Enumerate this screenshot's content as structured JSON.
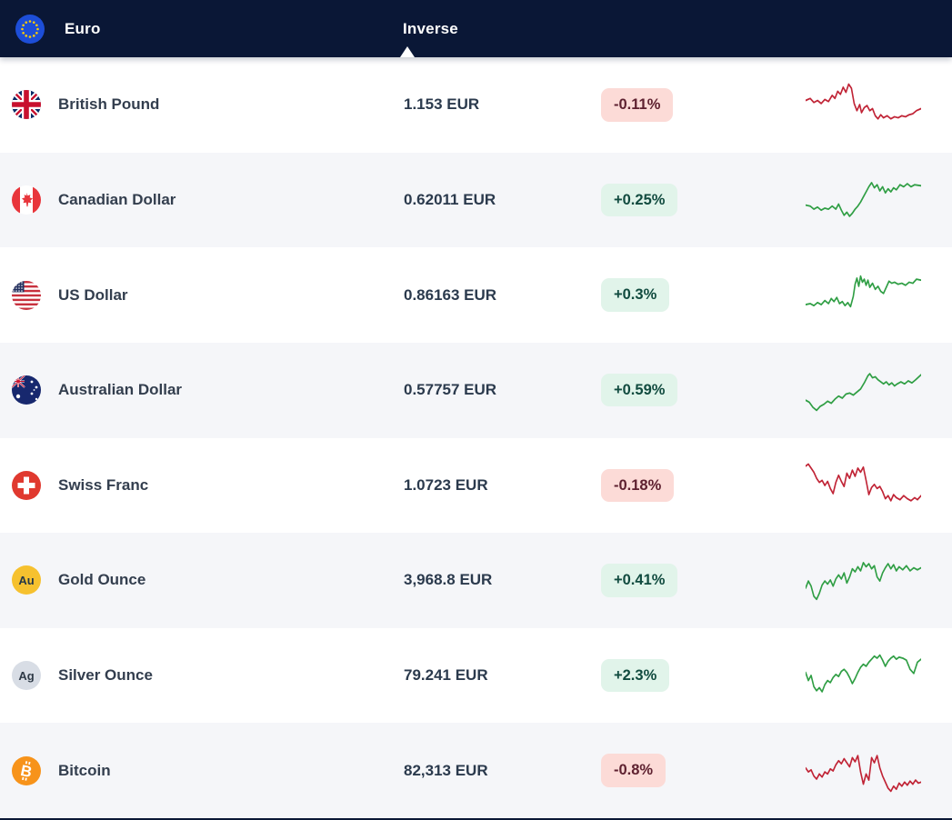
{
  "header": {
    "base_currency": "Euro",
    "inverse_label": "Inverse"
  },
  "colors": {
    "header_bg": "#0a1736",
    "spark_up": "#2f9e44",
    "spark_down": "#c02335",
    "badge_up_bg": "#e1f4ea",
    "badge_up_text": "#114b3f",
    "badge_down_bg": "#fcdbd7",
    "badge_down_text": "#5e2130",
    "row_alt_bg": "#f5f6f9"
  },
  "icons": {
    "eu": "eu-flag-icon",
    "gb": "uk-flag-icon",
    "ca": "canada-flag-icon",
    "us": "us-flag-icon",
    "au": "australia-flag-icon",
    "ch": "switzerland-flag-icon",
    "gold": "gold-au-icon",
    "silver": "silver-ag-icon",
    "btc": "bitcoin-icon"
  },
  "rows": [
    {
      "name": "British Pound",
      "icon": "gb",
      "rate": "1.153 EUR",
      "change": "-0.11%",
      "direction": "down",
      "spark": [
        [
          0,
          21
        ],
        [
          5,
          19
        ],
        [
          9,
          23
        ],
        [
          13,
          21
        ],
        [
          17,
          24
        ],
        [
          21,
          20
        ],
        [
          25,
          22
        ],
        [
          29,
          16
        ],
        [
          32,
          19
        ],
        [
          35,
          12
        ],
        [
          38,
          15
        ],
        [
          41,
          8
        ],
        [
          44,
          13
        ],
        [
          47,
          5
        ],
        [
          50,
          9
        ],
        [
          53,
          24
        ],
        [
          56,
          31
        ],
        [
          59,
          25
        ],
        [
          61,
          33
        ],
        [
          64,
          28
        ],
        [
          67,
          26
        ],
        [
          70,
          31
        ],
        [
          73,
          29
        ],
        [
          76,
          36
        ],
        [
          79,
          39
        ],
        [
          82,
          35
        ],
        [
          85,
          38
        ],
        [
          89,
          36
        ],
        [
          93,
          39
        ],
        [
          97,
          37
        ],
        [
          101,
          38
        ],
        [
          105,
          36
        ],
        [
          109,
          37
        ],
        [
          113,
          35
        ],
        [
          117,
          34
        ],
        [
          121,
          31
        ],
        [
          126,
          29
        ]
      ]
    },
    {
      "name": "Canadian Dollar",
      "icon": "ca",
      "rate": "0.62011 EUR",
      "change": "+0.25%",
      "direction": "up",
      "spark": [
        [
          0,
          30
        ],
        [
          5,
          31
        ],
        [
          9,
          34
        ],
        [
          13,
          32
        ],
        [
          17,
          35
        ],
        [
          21,
          33
        ],
        [
          25,
          34
        ],
        [
          29,
          31
        ],
        [
          33,
          34
        ],
        [
          36,
          29
        ],
        [
          39,
          35
        ],
        [
          42,
          40
        ],
        [
          45,
          37
        ],
        [
          48,
          41
        ],
        [
          51,
          38
        ],
        [
          54,
          34
        ],
        [
          57,
          31
        ],
        [
          60,
          27
        ],
        [
          63,
          22
        ],
        [
          66,
          17
        ],
        [
          69,
          12
        ],
        [
          72,
          8
        ],
        [
          75,
          13
        ],
        [
          78,
          10
        ],
        [
          81,
          16
        ],
        [
          84,
          12
        ],
        [
          87,
          18
        ],
        [
          90,
          14
        ],
        [
          93,
          17
        ],
        [
          96,
          13
        ],
        [
          99,
          15
        ],
        [
          103,
          10
        ],
        [
          107,
          12
        ],
        [
          111,
          9
        ],
        [
          115,
          12
        ],
        [
          119,
          10
        ],
        [
          126,
          11
        ]
      ]
    },
    {
      "name": "US Dollar",
      "icon": "us",
      "rate": "0.86163 EUR",
      "change": "+0.3%",
      "direction": "up",
      "spark": [
        [
          0,
          34
        ],
        [
          5,
          33
        ],
        [
          9,
          35
        ],
        [
          13,
          32
        ],
        [
          17,
          34
        ],
        [
          21,
          30
        ],
        [
          25,
          33
        ],
        [
          28,
          28
        ],
        [
          31,
          31
        ],
        [
          34,
          27
        ],
        [
          37,
          33
        ],
        [
          40,
          31
        ],
        [
          43,
          35
        ],
        [
          46,
          32
        ],
        [
          49,
          36
        ],
        [
          52,
          26
        ],
        [
          54,
          14
        ],
        [
          56,
          8
        ],
        [
          58,
          16
        ],
        [
          60,
          6
        ],
        [
          62,
          12
        ],
        [
          64,
          9
        ],
        [
          66,
          15
        ],
        [
          68,
          10
        ],
        [
          70,
          17
        ],
        [
          73,
          13
        ],
        [
          76,
          19
        ],
        [
          79,
          16
        ],
        [
          82,
          21
        ],
        [
          85,
          23
        ],
        [
          88,
          17
        ],
        [
          91,
          11
        ],
        [
          94,
          13
        ],
        [
          97,
          12
        ],
        [
          101,
          14
        ],
        [
          105,
          13
        ],
        [
          109,
          15
        ],
        [
          113,
          12
        ],
        [
          117,
          13
        ],
        [
          121,
          9
        ],
        [
          126,
          10
        ]
      ]
    },
    {
      "name": "Australian Dollar",
      "icon": "au",
      "rate": "0.57757 EUR",
      "change": "+0.59%",
      "direction": "up",
      "spark": [
        [
          0,
          35
        ],
        [
          4,
          37
        ],
        [
          8,
          42
        ],
        [
          12,
          45
        ],
        [
          16,
          41
        ],
        [
          20,
          39
        ],
        [
          24,
          36
        ],
        [
          28,
          38
        ],
        [
          32,
          34
        ],
        [
          36,
          31
        ],
        [
          40,
          33
        ],
        [
          44,
          29
        ],
        [
          48,
          28
        ],
        [
          52,
          30
        ],
        [
          56,
          27
        ],
        [
          60,
          24
        ],
        [
          64,
          18
        ],
        [
          68,
          11
        ],
        [
          70,
          9
        ],
        [
          73,
          13
        ],
        [
          76,
          12
        ],
        [
          79,
          15
        ],
        [
          82,
          17
        ],
        [
          85,
          19
        ],
        [
          88,
          17
        ],
        [
          91,
          20
        ],
        [
          94,
          18
        ],
        [
          97,
          21
        ],
        [
          100,
          19
        ],
        [
          104,
          17
        ],
        [
          108,
          19
        ],
        [
          112,
          16
        ],
        [
          116,
          18
        ],
        [
          120,
          15
        ],
        [
          126,
          10
        ]
      ]
    },
    {
      "name": "Swiss Franc",
      "icon": "ch",
      "rate": "1.0723 EUR",
      "change": "-0.18%",
      "direction": "down",
      "spark": [
        [
          0,
          6
        ],
        [
          3,
          4
        ],
        [
          6,
          8
        ],
        [
          9,
          12
        ],
        [
          12,
          18
        ],
        [
          15,
          22
        ],
        [
          18,
          20
        ],
        [
          21,
          25
        ],
        [
          24,
          21
        ],
        [
          27,
          28
        ],
        [
          30,
          33
        ],
        [
          33,
          22
        ],
        [
          36,
          15
        ],
        [
          39,
          21
        ],
        [
          42,
          26
        ],
        [
          45,
          13
        ],
        [
          48,
          18
        ],
        [
          51,
          10
        ],
        [
          54,
          16
        ],
        [
          57,
          8
        ],
        [
          60,
          12
        ],
        [
          63,
          7
        ],
        [
          66,
          20
        ],
        [
          69,
          34
        ],
        [
          72,
          27
        ],
        [
          75,
          24
        ],
        [
          78,
          28
        ],
        [
          81,
          26
        ],
        [
          84,
          31
        ],
        [
          87,
          38
        ],
        [
          90,
          35
        ],
        [
          93,
          40
        ],
        [
          96,
          34
        ],
        [
          99,
          37
        ],
        [
          103,
          39
        ],
        [
          107,
          35
        ],
        [
          111,
          38
        ],
        [
          115,
          40
        ],
        [
          119,
          37
        ],
        [
          122,
          39
        ],
        [
          126,
          35
        ]
      ]
    },
    {
      "name": "Gold Ounce",
      "icon": "gold",
      "icon_label": "Au",
      "rate": "3,968.8 EUR",
      "change": "+0.41%",
      "direction": "up",
      "spark": [
        [
          0,
          33
        ],
        [
          3,
          26
        ],
        [
          6,
          31
        ],
        [
          9,
          41
        ],
        [
          12,
          44
        ],
        [
          15,
          38
        ],
        [
          18,
          30
        ],
        [
          21,
          26
        ],
        [
          24,
          29
        ],
        [
          27,
          25
        ],
        [
          30,
          31
        ],
        [
          33,
          24
        ],
        [
          36,
          20
        ],
        [
          39,
          24
        ],
        [
          42,
          18
        ],
        [
          45,
          28
        ],
        [
          48,
          22
        ],
        [
          51,
          14
        ],
        [
          54,
          17
        ],
        [
          57,
          12
        ],
        [
          60,
          16
        ],
        [
          63,
          8
        ],
        [
          66,
          12
        ],
        [
          69,
          9
        ],
        [
          72,
          14
        ],
        [
          75,
          11
        ],
        [
          78,
          22
        ],
        [
          81,
          26
        ],
        [
          84,
          18
        ],
        [
          87,
          13
        ],
        [
          90,
          9
        ],
        [
          93,
          14
        ],
        [
          96,
          10
        ],
        [
          99,
          16
        ],
        [
          102,
          12
        ],
        [
          106,
          15
        ],
        [
          110,
          11
        ],
        [
          114,
          16
        ],
        [
          118,
          13
        ],
        [
          122,
          15
        ],
        [
          126,
          13
        ]
      ]
    },
    {
      "name": "Silver Ounce",
      "icon": "silver",
      "icon_label": "Ag",
      "rate": "79.241 EUR",
      "change": "+2.3%",
      "direction": "up",
      "spark": [
        [
          0,
          22
        ],
        [
          3,
          30
        ],
        [
          6,
          25
        ],
        [
          9,
          36
        ],
        [
          12,
          40
        ],
        [
          15,
          37
        ],
        [
          18,
          41
        ],
        [
          21,
          34
        ],
        [
          24,
          30
        ],
        [
          27,
          32
        ],
        [
          30,
          27
        ],
        [
          33,
          24
        ],
        [
          36,
          26
        ],
        [
          39,
          21
        ],
        [
          42,
          19
        ],
        [
          45,
          22
        ],
        [
          48,
          27
        ],
        [
          51,
          33
        ],
        [
          54,
          28
        ],
        [
          57,
          22
        ],
        [
          60,
          17
        ],
        [
          63,
          14
        ],
        [
          66,
          16
        ],
        [
          69,
          12
        ],
        [
          72,
          9
        ],
        [
          75,
          6
        ],
        [
          78,
          8
        ],
        [
          81,
          5
        ],
        [
          84,
          10
        ],
        [
          87,
          16
        ],
        [
          90,
          11
        ],
        [
          93,
          8
        ],
        [
          96,
          6
        ],
        [
          99,
          9
        ],
        [
          102,
          7
        ],
        [
          106,
          8
        ],
        [
          110,
          10
        ],
        [
          114,
          19
        ],
        [
          118,
          23
        ],
        [
          122,
          12
        ],
        [
          126,
          9
        ]
      ]
    },
    {
      "name": "Bitcoin",
      "icon": "btc",
      "rate": "82,313 EUR",
      "change": "-0.8%",
      "direction": "down",
      "spark": [
        [
          0,
          22
        ],
        [
          3,
          26
        ],
        [
          6,
          24
        ],
        [
          9,
          30
        ],
        [
          12,
          33
        ],
        [
          15,
          28
        ],
        [
          18,
          31
        ],
        [
          21,
          26
        ],
        [
          24,
          28
        ],
        [
          27,
          23
        ],
        [
          30,
          25
        ],
        [
          33,
          19
        ],
        [
          36,
          15
        ],
        [
          39,
          18
        ],
        [
          42,
          13
        ],
        [
          45,
          17
        ],
        [
          48,
          21
        ],
        [
          51,
          12
        ],
        [
          54,
          16
        ],
        [
          57,
          10
        ],
        [
          60,
          26
        ],
        [
          63,
          38
        ],
        [
          66,
          28
        ],
        [
          69,
          34
        ],
        [
          72,
          12
        ],
        [
          75,
          17
        ],
        [
          78,
          10
        ],
        [
          81,
          22
        ],
        [
          84,
          30
        ],
        [
          87,
          36
        ],
        [
          90,
          42
        ],
        [
          93,
          45
        ],
        [
          96,
          40
        ],
        [
          99,
          43
        ],
        [
          102,
          37
        ],
        [
          105,
          40
        ],
        [
          108,
          36
        ],
        [
          111,
          39
        ],
        [
          114,
          35
        ],
        [
          117,
          38
        ],
        [
          120,
          34
        ],
        [
          123,
          37
        ],
        [
          126,
          36
        ]
      ]
    }
  ]
}
